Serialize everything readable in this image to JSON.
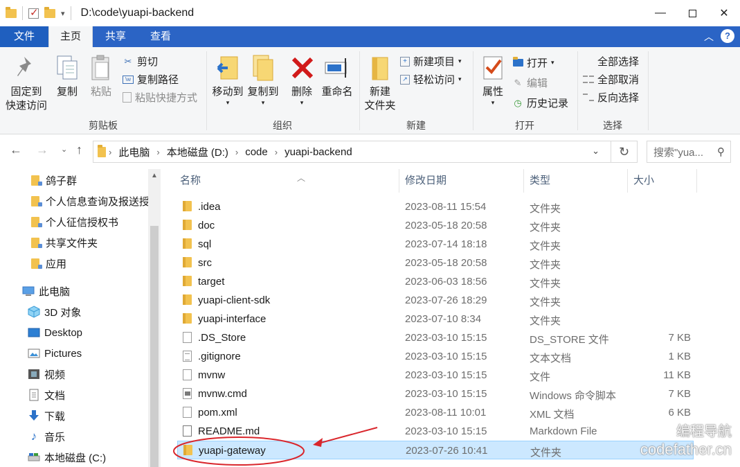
{
  "titlebar": {
    "title": "D:\\code\\yuapi-backend",
    "icons": [
      "folder-icon",
      "properties-check-icon",
      "new-folder-icon",
      "customize-dropdown-icon"
    ],
    "controls": [
      "minimize",
      "maximize",
      "close"
    ]
  },
  "ribbon_tabs": {
    "file": "文件",
    "home": "主页",
    "share": "共享",
    "view": "查看"
  },
  "ribbon": {
    "clipboard": {
      "label": "剪贴板",
      "pin_line1": "固定到",
      "pin_line2": "快速访问",
      "copy": "复制",
      "paste": "粘贴",
      "cut": "剪切",
      "copy_path": "复制路径",
      "paste_shortcut": "粘贴快捷方式"
    },
    "organize": {
      "label": "组织",
      "move_to": "移动到",
      "copy_to": "复制到",
      "delete": "删除",
      "rename": "重命名"
    },
    "new": {
      "label": "新建",
      "new_folder_line1": "新建",
      "new_folder_line2": "文件夹",
      "new_item": "新建项目",
      "easy_access": "轻松访问"
    },
    "open": {
      "label": "打开",
      "properties": "属性",
      "open": "打开",
      "edit": "编辑",
      "history": "历史记录"
    },
    "select": {
      "label": "选择",
      "select_all": "全部选择",
      "select_none": "全部取消",
      "invert": "反向选择"
    }
  },
  "navbar": {
    "breadcrumb": [
      "此电脑",
      "本地磁盘 (D:)",
      "code",
      "yuapi-backend"
    ],
    "search_placeholder": "搜索\"yua..."
  },
  "nav_pane": {
    "items": [
      {
        "label": "鸽子群",
        "icon": "pinned-folder-icon"
      },
      {
        "label": "个人信息查询及报送授",
        "icon": "pinned-folder-icon"
      },
      {
        "label": "个人征信授权书",
        "icon": "pinned-folder-icon"
      },
      {
        "label": "共享文件夹",
        "icon": "pinned-folder-icon"
      },
      {
        "label": "应用",
        "icon": "pinned-folder-icon"
      },
      {
        "label": "此电脑",
        "icon": "computer-icon"
      },
      {
        "label": "3D 对象",
        "icon": "3d-objects-icon"
      },
      {
        "label": "Desktop",
        "icon": "desktop-icon"
      },
      {
        "label": "Pictures",
        "icon": "pictures-icon"
      },
      {
        "label": "视频",
        "icon": "videos-icon"
      },
      {
        "label": "文档",
        "icon": "documents-icon"
      },
      {
        "label": "下载",
        "icon": "downloads-icon"
      },
      {
        "label": "音乐",
        "icon": "music-icon"
      },
      {
        "label": "本地磁盘 (C:)",
        "icon": "drive-icon"
      }
    ]
  },
  "file_list": {
    "columns": {
      "name": "名称",
      "date": "修改日期",
      "type": "类型",
      "size": "大小"
    },
    "rows": [
      {
        "name": ".idea",
        "date": "2023-08-11 15:54",
        "type": "文件夹",
        "size": "",
        "icon": "folder"
      },
      {
        "name": "doc",
        "date": "2023-05-18 20:58",
        "type": "文件夹",
        "size": "",
        "icon": "folder"
      },
      {
        "name": "sql",
        "date": "2023-07-14 18:18",
        "type": "文件夹",
        "size": "",
        "icon": "folder"
      },
      {
        "name": "src",
        "date": "2023-05-18 20:58",
        "type": "文件夹",
        "size": "",
        "icon": "folder"
      },
      {
        "name": "target",
        "date": "2023-06-03 18:56",
        "type": "文件夹",
        "size": "",
        "icon": "folder"
      },
      {
        "name": "yuapi-client-sdk",
        "date": "2023-07-26 18:29",
        "type": "文件夹",
        "size": "",
        "icon": "folder"
      },
      {
        "name": "yuapi-interface",
        "date": "2023-07-10 8:34",
        "type": "文件夹",
        "size": "",
        "icon": "folder"
      },
      {
        "name": ".DS_Store",
        "date": "2023-03-10 15:15",
        "type": "DS_STORE 文件",
        "size": "7 KB",
        "icon": "file"
      },
      {
        "name": ".gitignore",
        "date": "2023-03-10 15:15",
        "type": "文本文档",
        "size": "1 KB",
        "icon": "text"
      },
      {
        "name": "mvnw",
        "date": "2023-03-10 15:15",
        "type": "文件",
        "size": "11 KB",
        "icon": "file"
      },
      {
        "name": "mvnw.cmd",
        "date": "2023-03-10 15:15",
        "type": "Windows 命令脚本",
        "size": "7 KB",
        "icon": "cmd"
      },
      {
        "name": "pom.xml",
        "date": "2023-08-11 10:01",
        "type": "XML 文档",
        "size": "6 KB",
        "icon": "file"
      },
      {
        "name": "README.md",
        "date": "2023-03-10 15:15",
        "type": "Markdown File",
        "size": "",
        "icon": "md"
      },
      {
        "name": "yuapi-gateway",
        "date": "2023-07-26 10:41",
        "type": "文件夹",
        "size": "",
        "icon": "folder",
        "selected": true
      }
    ]
  },
  "watermark": {
    "line1": "编程导航",
    "line2": "codefather.cn"
  },
  "colors": {
    "accent": "#2b64c5",
    "selection": "#cce8ff",
    "annotation": "#d9262c",
    "folder": "#f2c24f"
  }
}
